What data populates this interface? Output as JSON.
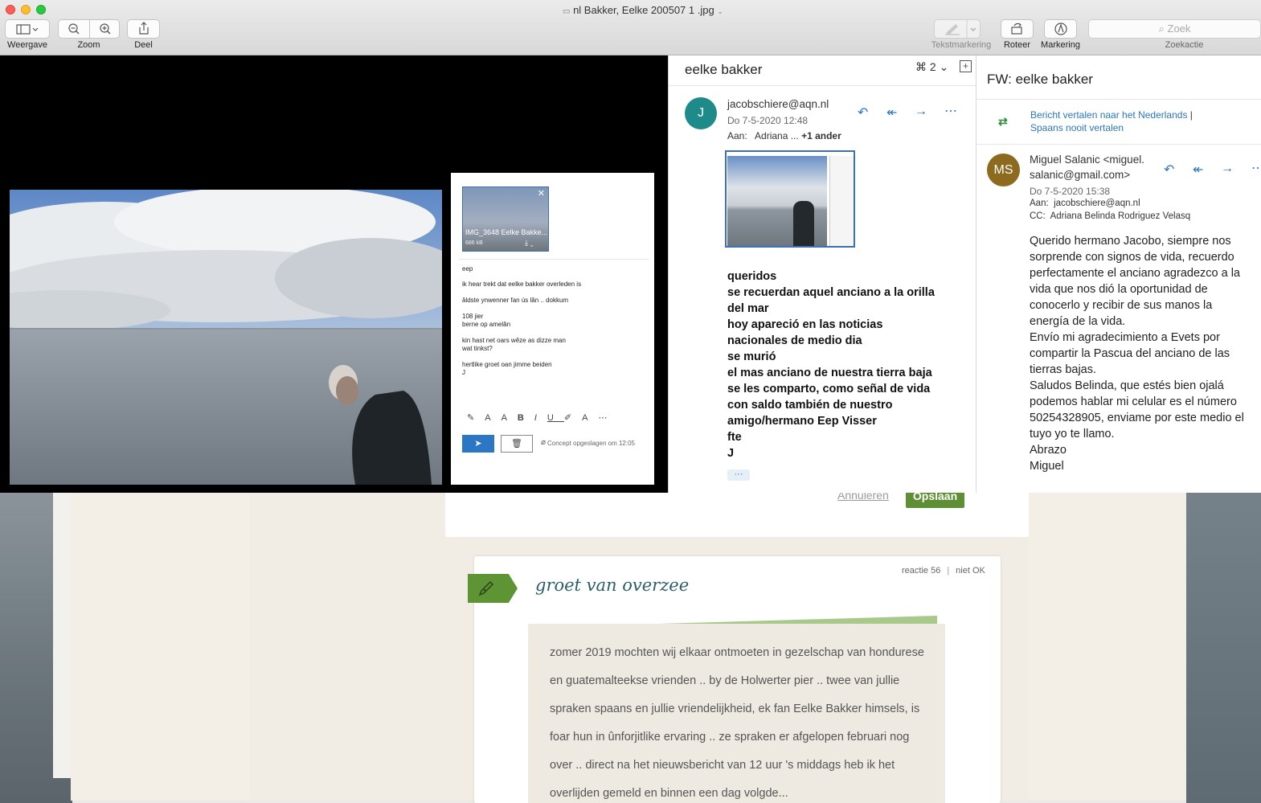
{
  "window": {
    "title": "nl Bakker, Eelke 200507 1 .jpg",
    "toolbar": {
      "view_label": "Weergave",
      "zoom_label": "Zoom",
      "share_label": "Deel",
      "textmark_label": "Tekstmarkering",
      "rotate_label": "Roteer",
      "markup_label": "Markering",
      "search_placeholder": "Zoek",
      "search_label": "Zoekactie"
    }
  },
  "compose": {
    "attachment_name": "IMG_3648 Eelke Bakke...",
    "attachment_size": "686 kB",
    "lines": [
      "eep",
      "ik hear trekt dat eelke bakker overleden is",
      "âldste ynwenner fan ús lân .. dokkum",
      "108 jier",
      "berne op amelân",
      "kin hast net oars wêze as dizze man",
      "wat tinkst?",
      "hertlike groet oan jimme beiden",
      "J"
    ],
    "status": "Concept opgeslagen om 12:05"
  },
  "mail1": {
    "subject": "eelke bakker",
    "attachment_count": "2",
    "avatar": "J",
    "from": "jacobschiere@aqn.nl",
    "date": "Do 7-5-2020 12:48",
    "to_label": "Aan:",
    "to_value": "Adriana ...",
    "to_more": "+1 ander",
    "body": [
      "queridos",
      "se recuerdan aquel anciano a la orilla",
      "del mar",
      "hoy apareció en las noticias",
      "nacionales de medio dia",
      "se murió",
      "el mas anciano de nuestra tierra baja",
      "se les comparto, como señal de vida",
      "con saldo también de nuestro",
      "amigo/hermano Eep Visser",
      "fte",
      "J"
    ],
    "more": "···"
  },
  "mail2": {
    "subject": "FW: eelke bakker",
    "translate_link": "Bericht vertalen naar het Nederlands",
    "translate_sep": "|",
    "never_translate": "Spaans nooit vertalen",
    "avatar": "MS",
    "from_line1": "Miguel Salanic <miguel.",
    "from_line2": "salanic@gmail.com>",
    "date": "Do 7-5-2020 15:38",
    "to_label": "Aan:",
    "to_value": "jacobschiere@aqn.nl",
    "cc_label": "CC:",
    "cc_value": "Adriana Belinda Rodriguez Velasq",
    "body": [
      "Querido hermano Jacobo, siempre nos",
      "sorprende con signos de vida, recuerdo",
      "perfectamente el anciano agradezco a la",
      "vida que nos dió la oportunidad de",
      "conocerlo y recibir de sus manos la",
      "energía de la vida.",
      "Envío mi agradecimiento a Evets por",
      "compartir la Pascua del anciano de las",
      "tierras bajas.",
      "Saludos Belinda, que estés bien ojalá",
      "podemos hablar mi celular es el número",
      "50254328905, enviame por este medio el",
      "tuyo yo te llamo.",
      "Abrazo",
      "Miguel"
    ]
  },
  "webpage": {
    "cancel_label": "Annuleren",
    "save_label": "Opslaan",
    "reactie": "reactie 56",
    "reactie_sep": "|",
    "not_ok": "niet OK",
    "comment_title": "groet van overzee",
    "comment_lines": [
      "zomer 2019 mochten wij elkaar ontmoeten in gezelschap van hondurese",
      "en guatemalteekse vrienden .. by de Holwerter pier .. twee van jullie",
      "spraken spaans en jullie vriendelijkheid, ek fan Eelke Bakker himsels, is",
      "foar hun in ûnforjitlike ervaring .. ze spraken er afgelopen februari nog",
      "over .. direct na het nieuwsbericht van 12 uur 's middags heb ik het",
      "overlijden gemeld en binnen een dag volgde..."
    ]
  },
  "colors": {
    "outlook_blue": "#2b76c5",
    "avatar_j": "#1f8a8a",
    "avatar_ms": "#8d6a1e",
    "save_green": "#5f8f35",
    "title_teal": "#2b5d6b"
  }
}
